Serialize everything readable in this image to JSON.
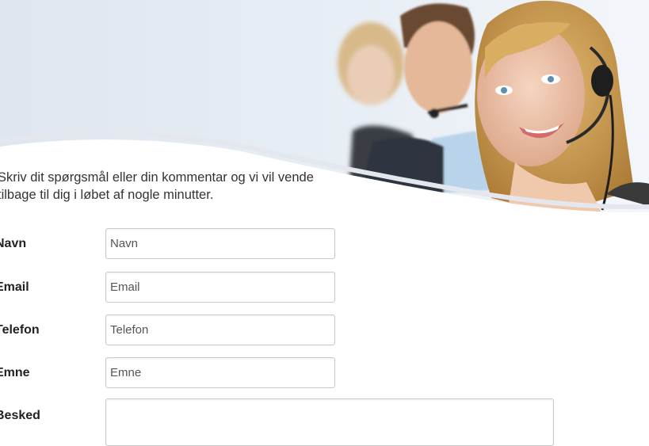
{
  "intro_text": "Skriv dit spørgsmål eller din kommentar og vi vil vende tilbage til dig i løbet af nogle minutter.",
  "form": {
    "fields": [
      {
        "label": "Navn",
        "placeholder": "Navn"
      },
      {
        "label": "Email",
        "placeholder": "Email"
      },
      {
        "label": "Telefon",
        "placeholder": "Telefon"
      },
      {
        "label": "Emne",
        "placeholder": "Emne"
      },
      {
        "label": "Besked",
        "placeholder": ""
      }
    ]
  },
  "colors": {
    "banner_bg": "#e3eaf3",
    "field_border": "#c9c9c9",
    "text": "#222222"
  }
}
